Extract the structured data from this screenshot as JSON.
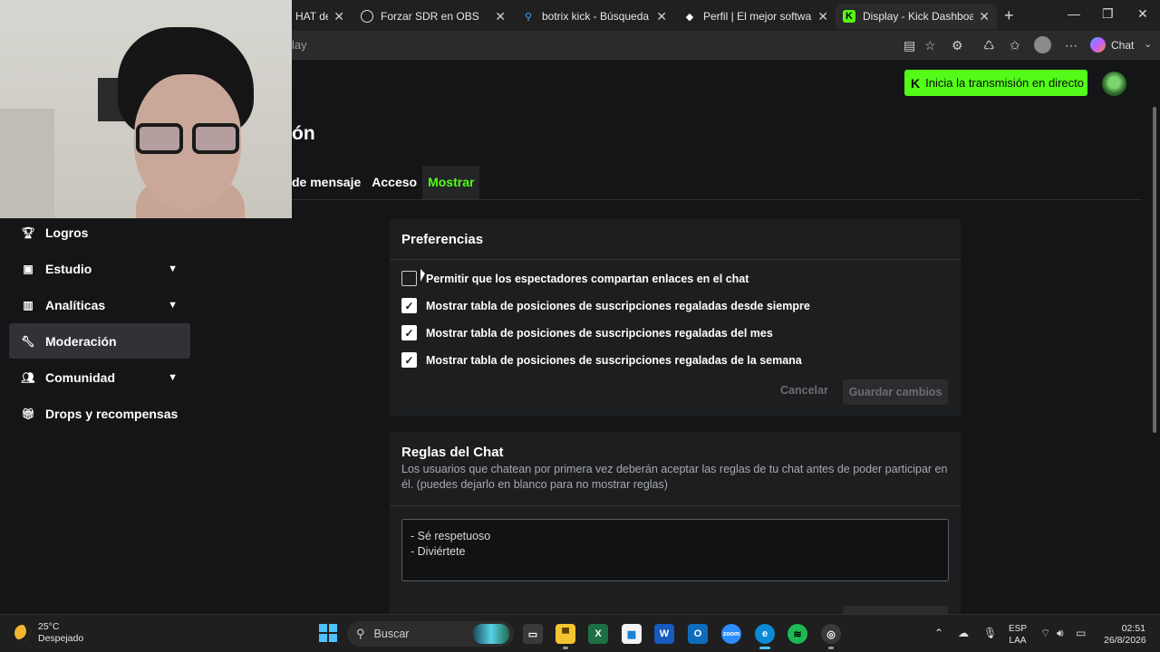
{
  "browser": {
    "tabs": [
      {
        "label": "HAT de KIC",
        "icon": "kick-icon",
        "active": false
      },
      {
        "label": "Forzar SDR en OBS",
        "icon": "chatgpt-icon",
        "active": false
      },
      {
        "label": "botrix kick - Búsqueda",
        "icon": "search-icon",
        "active": false
      },
      {
        "label": "Perfil | El mejor software para",
        "icon": "botrix-icon",
        "active": false
      },
      {
        "label": "Display - Kick Dashboard",
        "icon": "kick-icon",
        "active": true
      }
    ],
    "address_text": "lay",
    "copilot_label": "Chat"
  },
  "header": {
    "go_live_label": "Inicia la transmisión en directo"
  },
  "page": {
    "title_partial": "ón",
    "tabs": [
      {
        "label": "de mensaje",
        "active": false
      },
      {
        "label": "Acceso",
        "active": false
      },
      {
        "label": "Mostrar",
        "active": true
      }
    ]
  },
  "sidebar": {
    "items": [
      {
        "label": "Logros",
        "icon": "trophy-icon",
        "has_chevron": false,
        "active": false
      },
      {
        "label": "Estudio",
        "icon": "studio-icon",
        "has_chevron": true,
        "active": false
      },
      {
        "label": "Analíticas",
        "icon": "chart-icon",
        "has_chevron": true,
        "active": false
      },
      {
        "label": "Moderación",
        "icon": "wrench-icon",
        "has_chevron": false,
        "active": true
      },
      {
        "label": "Comunidad",
        "icon": "people-icon",
        "has_chevron": true,
        "active": false
      },
      {
        "label": "Drops y recompensas",
        "icon": "gift-icon",
        "has_chevron": false,
        "active": false
      }
    ]
  },
  "preferences": {
    "heading": "Preferencias",
    "options": [
      {
        "label": "Permitir que los espectadores compartan enlaces en el chat",
        "checked": false
      },
      {
        "label": "Mostrar tabla de posiciones de suscripciones regaladas desde siempre",
        "checked": true
      },
      {
        "label": "Mostrar tabla de posiciones de suscripciones regaladas del mes",
        "checked": true
      },
      {
        "label": "Mostrar tabla de posiciones de suscripciones regaladas de la semana",
        "checked": true
      }
    ],
    "cancel_label": "Cancelar",
    "save_label": "Guardar cambios"
  },
  "chat_rules": {
    "heading": "Reglas del Chat",
    "description": "Los usuarios que chatean por primera vez deberán aceptar las reglas de tu chat antes de poder participar en él. (puedes dejarlo en blanco para no mostrar reglas)",
    "rules_text": "- Sé respetuoso\n- Diviértete"
  },
  "taskbar": {
    "weather_temp": "25°C",
    "weather_desc": "Despejado",
    "search_placeholder": "Buscar",
    "lang_line1": "ESP",
    "lang_line2": "LAA",
    "time": "02:51",
    "date": "26/8/2026"
  },
  "colors": {
    "accent": "#53fc18",
    "background": "#141517",
    "panel": "#1c1e20"
  }
}
